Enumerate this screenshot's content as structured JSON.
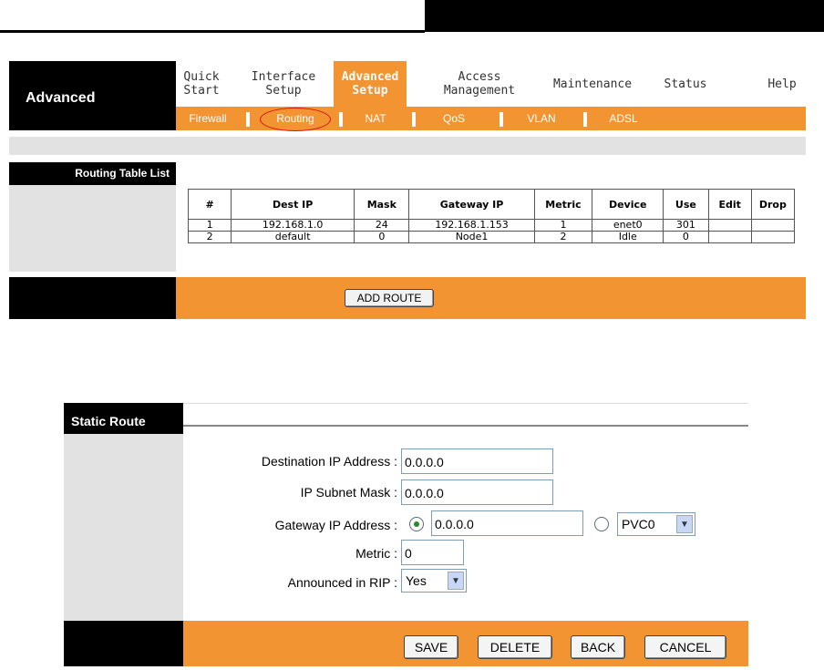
{
  "section_title": "Advanced",
  "nav": [
    {
      "label": "Quick\nStart"
    },
    {
      "label": "Interface\nSetup"
    },
    {
      "label": "Advanced\nSetup",
      "active": true
    },
    {
      "label": "Access\nManagement"
    },
    {
      "label": "Maintenance"
    },
    {
      "label": "Status"
    },
    {
      "label": "Help"
    }
  ],
  "subnav": [
    "Firewall",
    "Routing",
    "NAT",
    "QoS",
    "VLAN",
    "ADSL"
  ],
  "routing_table": {
    "label": "Routing Table List",
    "headers": [
      "#",
      "Dest IP",
      "Mask",
      "Gateway IP",
      "Metric",
      "Device",
      "Use",
      "Edit",
      "Drop"
    ],
    "rows": [
      [
        "1",
        "192.168.1.0",
        "24",
        "192.168.1.153",
        "1",
        "enet0",
        "301",
        "",
        ""
      ],
      [
        "2",
        "default",
        "0",
        "Node1",
        "2",
        "Idle",
        "0",
        "",
        ""
      ]
    ],
    "add_route_label": "ADD ROUTE"
  },
  "static_route": {
    "title": "Static Route",
    "dest_ip_label": "Destination IP Address :",
    "dest_ip_value": "0.0.0.0",
    "subnet_label": "IP Subnet Mask :",
    "subnet_value": "0.0.0.0",
    "gateway_label": "Gateway IP Address :",
    "gateway_value": "0.0.0.0",
    "pvc_value": "PVC0",
    "metric_label": "Metric :",
    "metric_value": "0",
    "rip_label": "Announced in RIP :",
    "rip_value": "Yes",
    "buttons": {
      "save": "SAVE",
      "delete": "DELETE",
      "back": "BACK",
      "cancel": "CANCEL"
    }
  },
  "colors": {
    "accent": "#f39432",
    "dark": "#000000",
    "panel": "#e2e2e2"
  }
}
